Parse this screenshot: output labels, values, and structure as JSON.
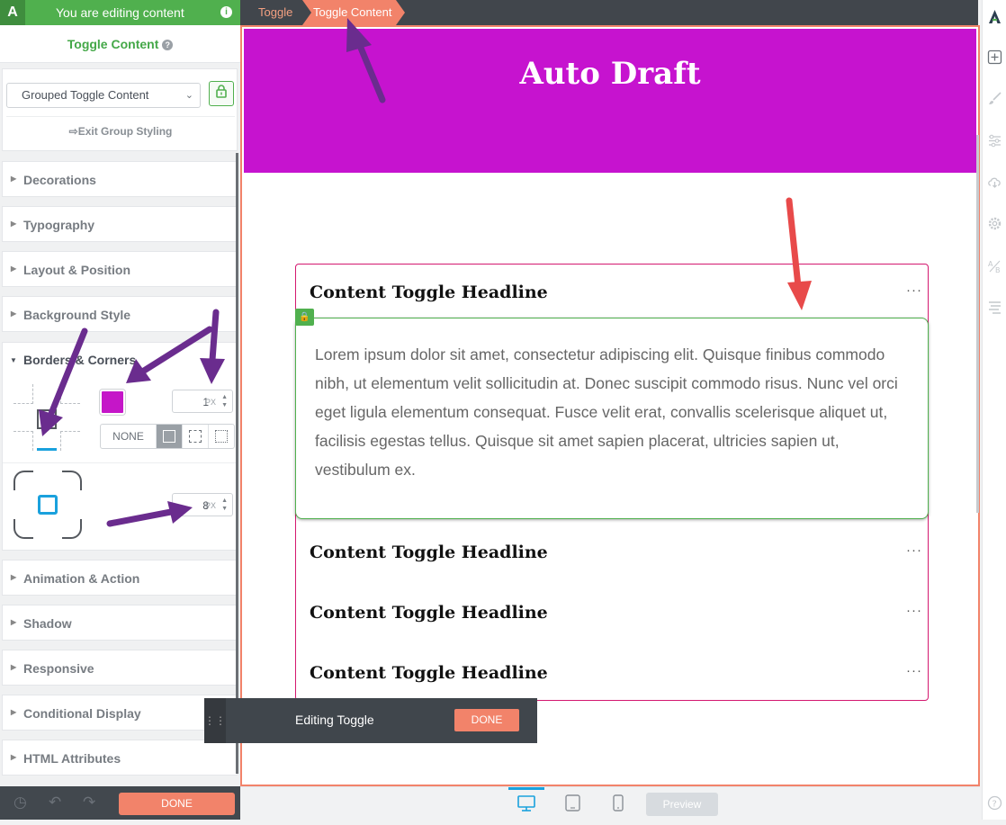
{
  "app": {
    "editing_banner": "You are editing content",
    "panel_title": "Toggle Content",
    "logo_letter": "A"
  },
  "breadcrumb": [
    "Toggle",
    "Toggle Content"
  ],
  "group_styling": {
    "selected": "Grouped Toggle Content",
    "exit_label": "Exit Group Styling"
  },
  "sections": {
    "decorations": "Decorations",
    "typography": "Typography",
    "layout": "Layout & Position",
    "background": "Background Style",
    "borders": "Borders & Corners",
    "animation": "Animation & Action",
    "shadow": "Shadow",
    "responsive": "Responsive",
    "conditional": "Conditional Display",
    "html_attributes": "HTML Attributes"
  },
  "borders": {
    "color": "#c516c8",
    "width_value": "1",
    "width_unit": "PX",
    "style_none": "NONE",
    "radius_value": "8",
    "radius_unit": "PX"
  },
  "footer": {
    "done_label": "DONE"
  },
  "page": {
    "hero_title": "Auto Draft",
    "hero_color": "#c613cf",
    "toggle_headlines": [
      "Content Toggle Headline",
      "Content Toggle Headline",
      "Content Toggle Headline",
      "Content Toggle Headline"
    ],
    "toggle_more": "···",
    "toggle_body": "Lorem ipsum dolor sit amet, consectetur adipiscing elit. Quisque finibus commodo nibh, ut elementum velit sollicitudin at. Donec suscipit commodo risus. Nunc vel orci eget ligula elementum consequat. Fusce velit erat, convallis scelerisque aliquet ut, facilisis egestas tellus. Quisque sit amet sapien placerat, ultricies sapien ut, vestibulum ex."
  },
  "floating_bar": {
    "label": "Editing Toggle",
    "done_label": "DONE"
  },
  "bottom_bar": {
    "preview_label": "Preview"
  },
  "colors": {
    "accent_green": "#50b04e",
    "accent_orange": "#f2836a",
    "accent_blue": "#1aa1dd"
  }
}
